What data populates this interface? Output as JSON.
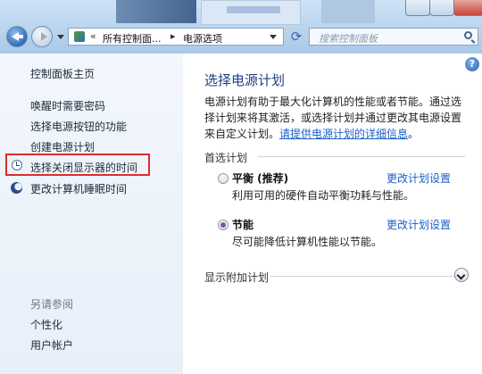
{
  "address_bar": {
    "crumb_separator": "«",
    "crumb_1": "所有控制面...",
    "crumb_arrow": "▸",
    "crumb_2": "电源选项",
    "search_placeholder": "搜索控制面板"
  },
  "sidebar": {
    "home": "控制面板主页",
    "items": [
      {
        "label": "唤醒时需要密码"
      },
      {
        "label": "选择电源按钮的功能"
      },
      {
        "label": "创建电源计划"
      },
      {
        "label": "选择关闭显示器的时间"
      },
      {
        "label": "更改计算机睡眠时间"
      }
    ],
    "see_also": "另请参阅",
    "see_also_items": [
      {
        "label": "个性化"
      },
      {
        "label": "用户帐户"
      }
    ]
  },
  "main": {
    "help": "?",
    "title": "选择电源计划",
    "description": "电源计划有助于最大化计算机的性能或者节能。通过选择计划来将其激活，或选择计划并通过更改其电源设置来自定义计划。",
    "description_link": "请提供电源计划的详细信息",
    "description_end": "。",
    "preferred_label": "首选计划",
    "plans": [
      {
        "name": "平衡 (推荐)",
        "desc": "利用可用的硬件自动平衡功耗与性能。",
        "link": "更改计划设置",
        "selected": false
      },
      {
        "name": "节能",
        "desc": "尽可能降低计算机性能以节能。",
        "link": "更改计划设置",
        "selected": true
      }
    ],
    "extra_label": "显示附加计划"
  },
  "colors": {
    "highlight_box": "#e02b2b",
    "link": "#1a5fc8",
    "title": "#1e3f82"
  }
}
